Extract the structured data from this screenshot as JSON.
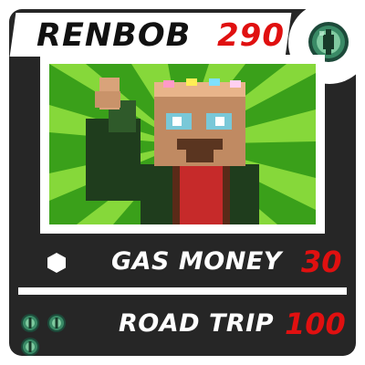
{
  "card": {
    "name": "RENBOB",
    "hp": "290",
    "type_icon": "ender-eye-icon"
  },
  "attacks": [
    {
      "name": "GAS MONEY",
      "damage": "30",
      "cost_icons": [
        "colorless-hexagon-icon"
      ]
    },
    {
      "name": "ROAD TRIP",
      "damage": "100",
      "cost_icons": [
        "ender-eye-icon",
        "ender-eye-icon",
        "ender-eye-icon"
      ]
    }
  ],
  "colors": {
    "card_background": "#262626",
    "hp_color": "#e01010",
    "art_background_green": "#3aa01a",
    "eye_green": "#3d7a5c"
  }
}
